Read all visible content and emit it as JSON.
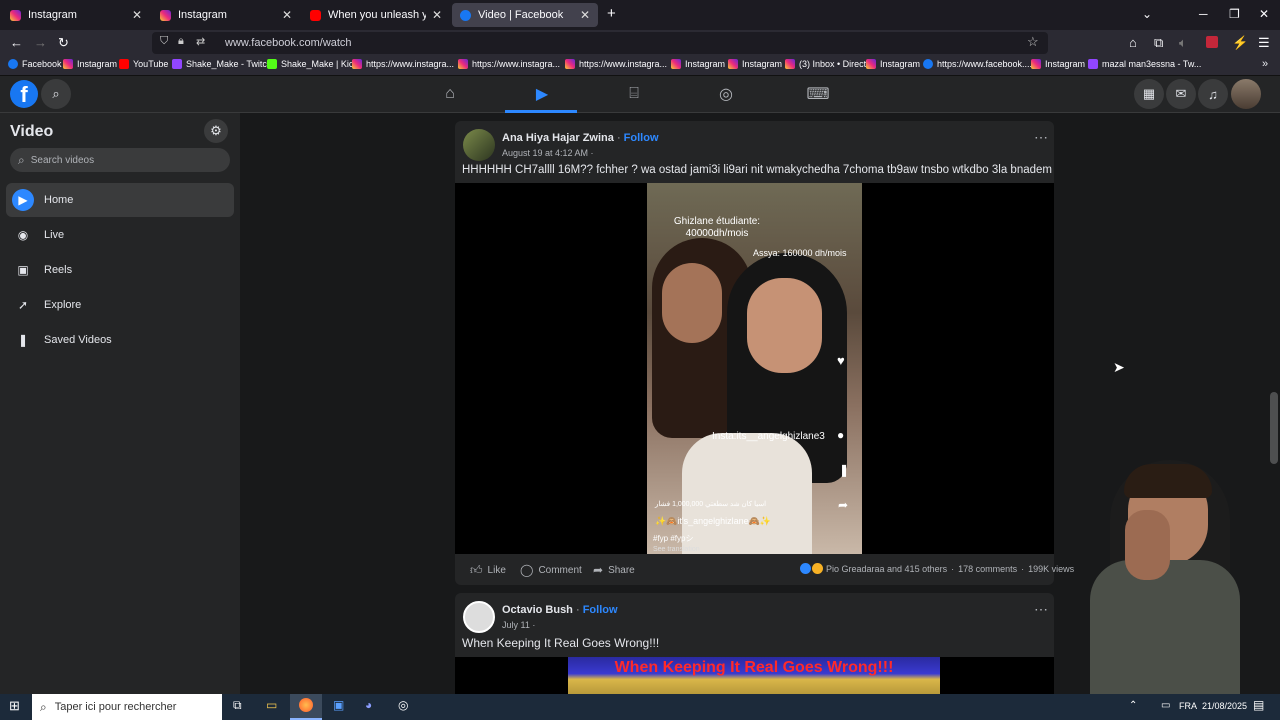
{
  "browser": {
    "tabs": [
      {
        "label": "Instagram",
        "icon": "instagram-icon"
      },
      {
        "label": "Instagram",
        "icon": "instagram-icon"
      },
      {
        "label": "When you unleash your tru",
        "icon": "sound-icon"
      },
      {
        "label": "Video | Facebook",
        "icon": "facebook-icon",
        "active": true
      }
    ],
    "url": "www.facebook.com/watch",
    "bookmarks": [
      "Facebook",
      "Instagram",
      "YouTube",
      "Shake_Make - Twitch",
      "Shake_Make | Kick",
      "https://www.instagra...",
      "https://www.instagra...",
      "https://www.instagra...",
      "Instagram",
      "Instagram",
      "(3) Inbox • Direct",
      "Instagram",
      "https://www.facebook....",
      "Instagram",
      "mazal man3essna - Tw..."
    ]
  },
  "sidebar": {
    "title": "Video",
    "search_placeholder": "Search videos",
    "items": [
      {
        "label": "Home",
        "icon": "play-icon"
      },
      {
        "label": "Live",
        "icon": "live-icon"
      },
      {
        "label": "Reels",
        "icon": "reels-icon"
      },
      {
        "label": "Explore",
        "icon": "rocket-icon"
      },
      {
        "label": "Saved Videos",
        "icon": "bookmark-icon"
      }
    ]
  },
  "post1": {
    "author": "Ana Hiya Hajar Zwina",
    "follow": "Follow",
    "date": "August 19 at 4:12 AM ·",
    "text": "HHHHHH CH7allll 16M?? fchher ? wa ostad jami3i li9ari nit wmakychedha 7choma tb9aw tnsbo wtkdbo 3la bnadem",
    "overlay1": "Ghizlane étudiante:",
    "overlay2": "40000dh/mois",
    "overlay3": "Assya: 160000 dh/mois",
    "overlay4": "Insta:its__angelghizlane3",
    "overlay5": "اسيا كان شد سطعتي 1,000,000 فشار",
    "overlay6": "✨🙈it's_angelghizlane🙈✨",
    "overlay7": "#fyp #fypシ",
    "overlay8": "See translation",
    "like": "Like",
    "comment": "Comment",
    "share": "Share",
    "reactions": "Pio Greadaraa and 415 others",
    "comments": "178 comments",
    "views": "199K views"
  },
  "post2": {
    "author": "Octavio Bush",
    "follow": "Follow",
    "date": "July 11 ·",
    "text": "When Keeping It Real Goes Wrong!!!",
    "banner": "When Keeping It Real Goes Wrong!!!"
  },
  "taskbar": {
    "search": "Taper ici pour rechercher",
    "lang": "FRA",
    "date": "21/08/2025"
  },
  "colors": {
    "accent": "#2d88ff",
    "bg": "#18191a",
    "card": "#242526"
  }
}
